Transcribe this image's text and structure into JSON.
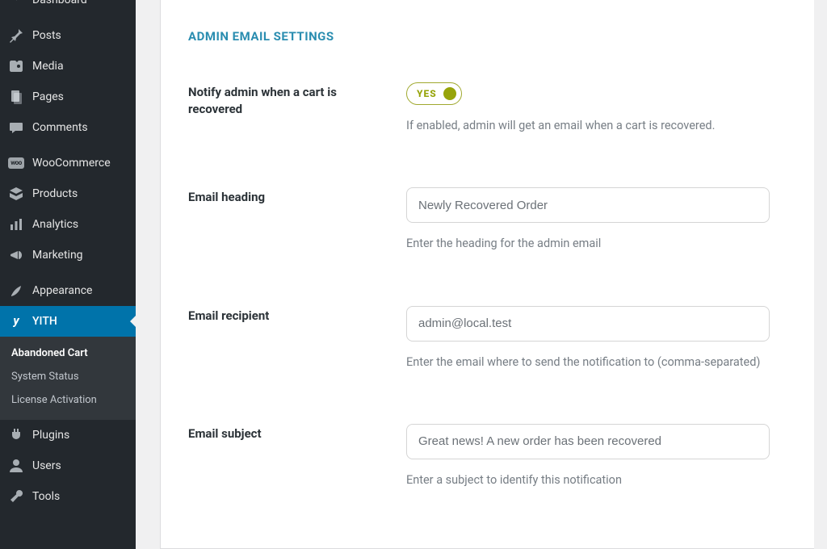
{
  "sidebar": {
    "items": [
      {
        "label": "Dashboard",
        "icon": "dashboard-icon"
      },
      {
        "label": "Posts",
        "icon": "pin-icon"
      },
      {
        "label": "Media",
        "icon": "media-icon"
      },
      {
        "label": "Pages",
        "icon": "pages-icon"
      },
      {
        "label": "Comments",
        "icon": "comments-icon"
      },
      {
        "label": "WooCommerce",
        "icon": "woo-icon"
      },
      {
        "label": "Products",
        "icon": "products-icon"
      },
      {
        "label": "Analytics",
        "icon": "analytics-icon"
      },
      {
        "label": "Marketing",
        "icon": "marketing-icon"
      },
      {
        "label": "Appearance",
        "icon": "appearance-icon"
      },
      {
        "label": "YITH",
        "icon": "yith-icon"
      },
      {
        "label": "Plugins",
        "icon": "plugins-icon"
      },
      {
        "label": "Users",
        "icon": "users-icon"
      },
      {
        "label": "Tools",
        "icon": "tools-icon"
      }
    ],
    "submenu": {
      "items": [
        {
          "label": "Abandoned Cart"
        },
        {
          "label": "System Status"
        },
        {
          "label": "License Activation"
        }
      ]
    }
  },
  "panel": {
    "title": "ADMIN EMAIL SETTINGS",
    "fields": {
      "notify": {
        "label": "Notify admin when a cart is recovered",
        "toggle_text": "YES",
        "desc": "If enabled, admin will get an email when a cart is recovered."
      },
      "heading": {
        "label": "Email heading",
        "value": "Newly Recovered Order",
        "desc": "Enter the heading for the admin email"
      },
      "recipient": {
        "label": "Email recipient",
        "value": "admin@local.test",
        "desc": "Enter the email where to send the notification to (comma-separated)"
      },
      "subject": {
        "label": "Email subject",
        "value": "Great news! A new order has been recovered",
        "desc": "Enter a subject to identify this notification"
      }
    }
  },
  "colors": {
    "section_title": "#2a8db0",
    "toggle_on": "#97a40a",
    "sidebar_active": "#0073aa"
  }
}
